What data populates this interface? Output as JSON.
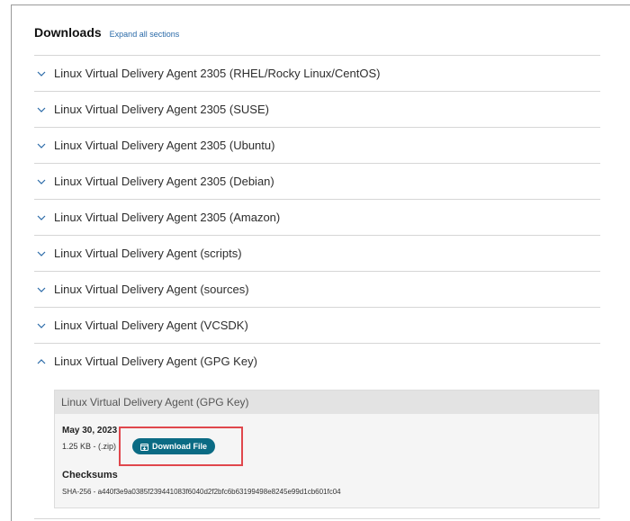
{
  "header": {
    "title": "Downloads",
    "expand_all": "Expand all sections"
  },
  "sections": [
    {
      "label": "Linux Virtual Delivery Agent 2305 (RHEL/Rocky Linux/CentOS)",
      "expanded": false
    },
    {
      "label": "Linux Virtual Delivery Agent 2305 (SUSE)",
      "expanded": false
    },
    {
      "label": "Linux Virtual Delivery Agent 2305 (Ubuntu)",
      "expanded": false
    },
    {
      "label": "Linux Virtual Delivery Agent 2305 (Debian)",
      "expanded": false
    },
    {
      "label": "Linux Virtual Delivery Agent 2305 (Amazon)",
      "expanded": false
    },
    {
      "label": "Linux Virtual Delivery Agent (scripts)",
      "expanded": false
    },
    {
      "label": "Linux Virtual Delivery Agent (sources)",
      "expanded": false
    },
    {
      "label": "Linux Virtual Delivery Agent (VCSDK)",
      "expanded": false
    },
    {
      "label": "Linux Virtual Delivery Agent (GPG Key)",
      "expanded": true
    }
  ],
  "panel": {
    "title": "Linux Virtual Delivery Agent (GPG Key)",
    "date": "May 30, 2023",
    "size": "1.25 KB - (.zip)",
    "download_label": "Download File",
    "checksums_title": "Checksums",
    "checksum": "SHA-256 - a440f3e9a0385f239441083f6040d2f2bfc6b63199498e8245e99d1cb601fc04"
  },
  "colors": {
    "button": "#0b6b84",
    "highlight": "#e0474c",
    "link": "#2a6aa8"
  }
}
